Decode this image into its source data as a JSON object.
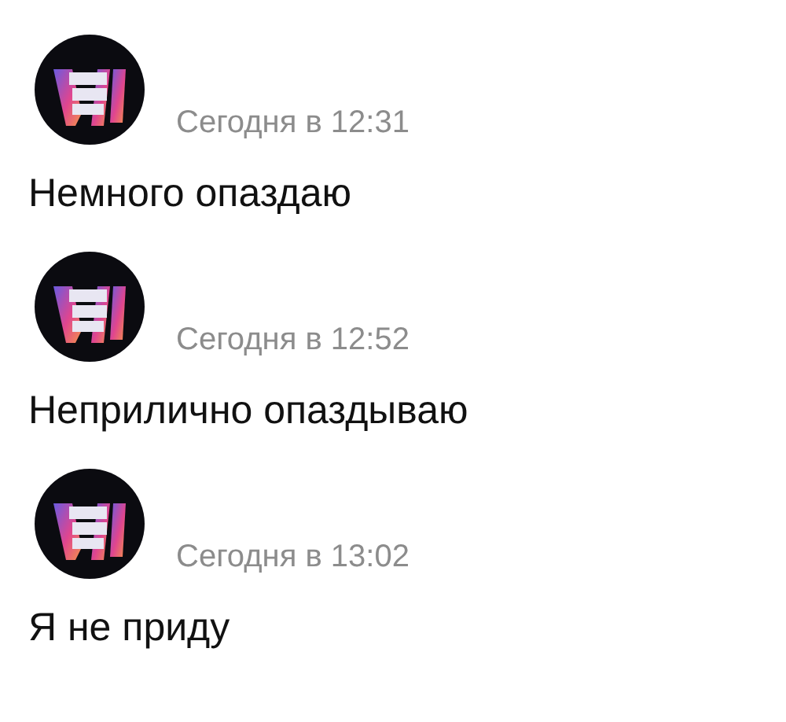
{
  "messages": [
    {
      "time": "Сегодня в 12:31",
      "text": "Немного опаздаю"
    },
    {
      "time": "Сегодня в 12:52",
      "text": "Неприлично опаздываю"
    },
    {
      "time": "Сегодня в 13:02",
      "text": "Я не приду"
    }
  ]
}
